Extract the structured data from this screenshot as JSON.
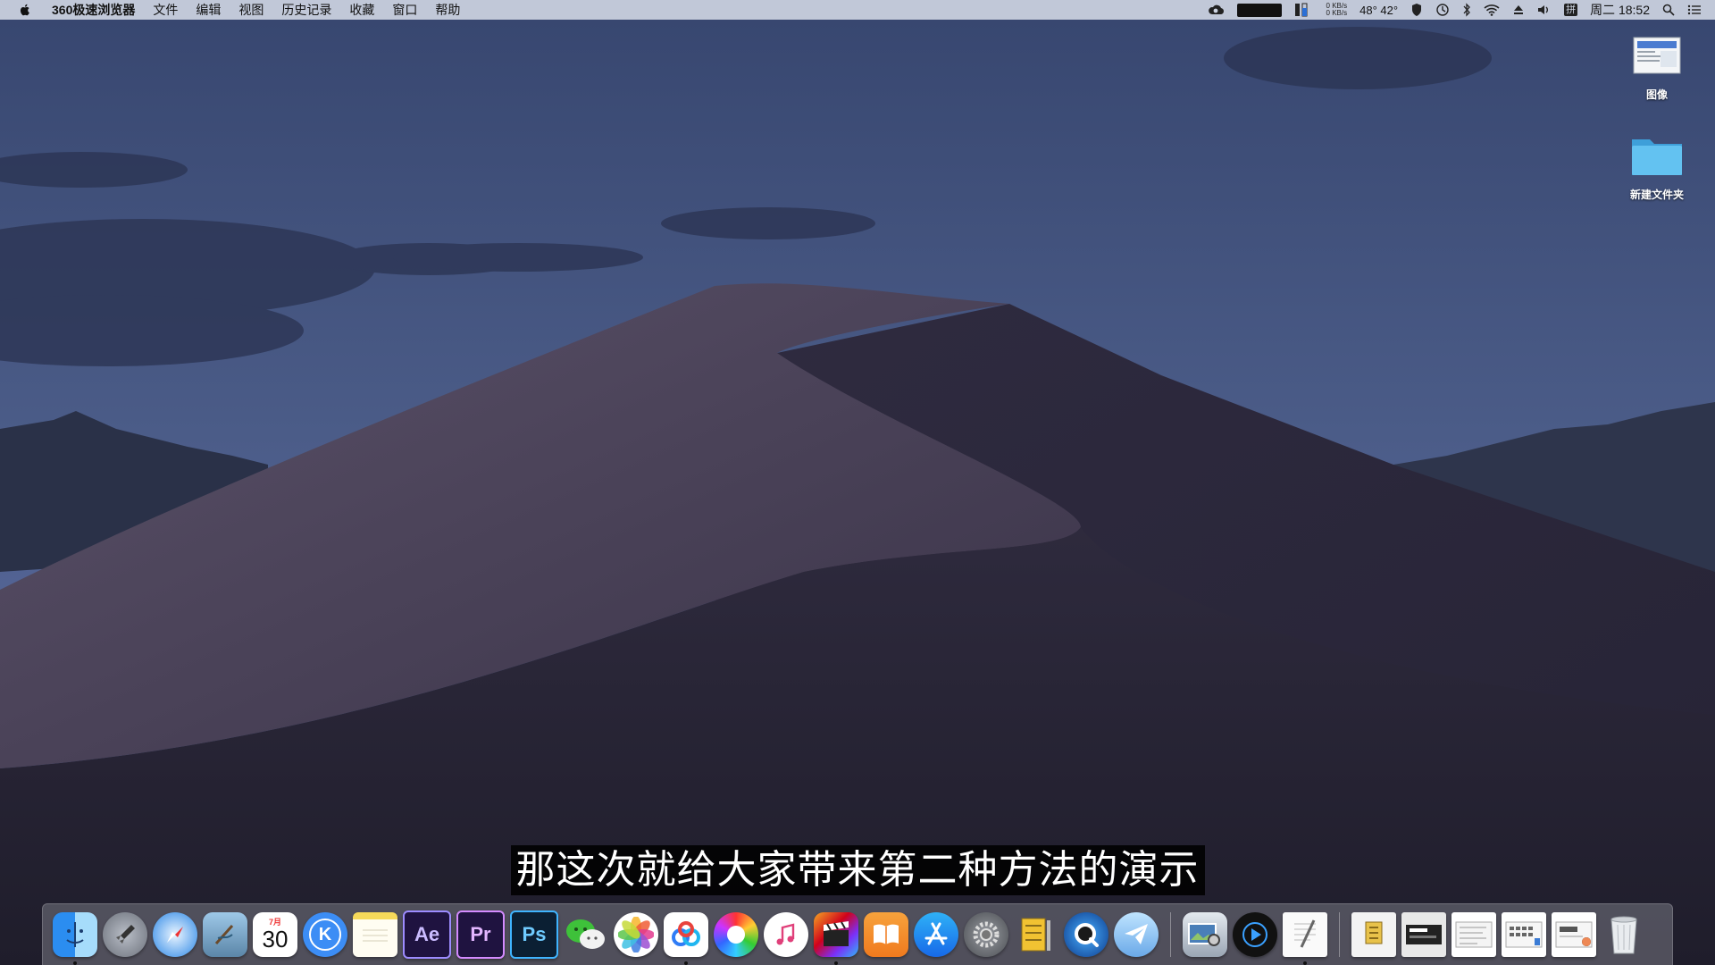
{
  "menubar": {
    "app_name": "360极速浏览器",
    "items": [
      "文件",
      "编辑",
      "视图",
      "历史记录",
      "收藏",
      "窗口",
      "帮助"
    ],
    "network_up": "0 KB/s",
    "network_down": "0 KB/s",
    "temperature": "48° 42°",
    "input_method": "拼",
    "clock": "周二 18:52"
  },
  "desktop": {
    "icons": [
      {
        "label": "图像",
        "icon": "image-document-icon"
      },
      {
        "label": "新建文件夹",
        "icon": "folder-icon"
      }
    ]
  },
  "subtitle": "那这次就给大家带来第二种方法的演示",
  "dock": {
    "calendar_month": "7月",
    "calendar_day": "30",
    "ae_label": "Ae",
    "pr_label": "Pr",
    "ps_label": "Ps",
    "k_label": "K"
  },
  "colors": {
    "sky_top": "#3a4872",
    "sky_bottom": "#54658f",
    "dune": "#3b3650",
    "menubar": "#cdd4e1"
  }
}
